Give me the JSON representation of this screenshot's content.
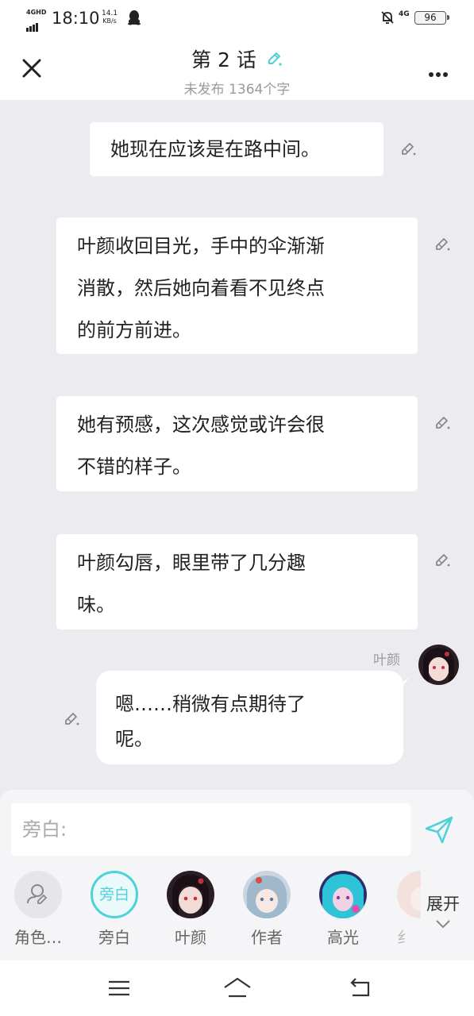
{
  "status_bar": {
    "network_type": "4GHD",
    "time": "18:10",
    "speed_value": "14.1",
    "speed_unit": "KB/s",
    "mobile_type": "4G",
    "battery": "96"
  },
  "header": {
    "title": "第 2 话",
    "subtitle": "未发布 1364个字"
  },
  "messages": [
    {
      "type": "narration",
      "text": "她现在应该是在路中间。"
    },
    {
      "type": "narration",
      "lines": [
        "叶颜收回目光，手中的伞渐渐",
        "消散，然后她向着看不见终点",
        "的前方前进。"
      ]
    },
    {
      "type": "narration",
      "lines": [
        "她有预感，这次感觉或许会很",
        "不错的样子。"
      ]
    },
    {
      "type": "narration",
      "lines": [
        "叶颜勾唇，眼里带了几分趣",
        "味。"
      ]
    },
    {
      "type": "dialogue",
      "speaker": "叶颜",
      "lines": [
        "嗯……稍微有点期待了",
        "呢。"
      ]
    }
  ],
  "composer": {
    "placeholder": "旁白:"
  },
  "roles": [
    {
      "label": "角色…",
      "icon": "add-role-icon"
    },
    {
      "label": "旁白",
      "circle_text": "旁白"
    },
    {
      "label": "叶颜"
    },
    {
      "label": "作者"
    },
    {
      "label": "高光"
    },
    {
      "label": "纟"
    }
  ],
  "expand_label": "展开",
  "colors": {
    "accent": "#4ed2da",
    "background": "#ececf0"
  }
}
